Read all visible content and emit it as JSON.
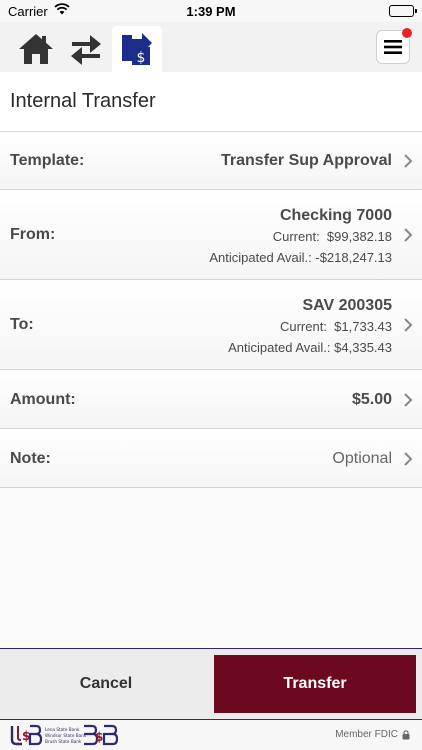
{
  "status_bar": {
    "carrier": "Carrier",
    "time": "1:39 PM",
    "battery_level": 100
  },
  "toolbar": {
    "icons": [
      "home-icon",
      "swap-icon",
      "transfer-icon",
      "menu-icon"
    ],
    "active_icon_color": "#1b2c8a",
    "notification_color": "#e8222b"
  },
  "page": {
    "title": "Internal Transfer"
  },
  "form": {
    "template": {
      "label": "Template:",
      "value": "Transfer Sup Approval"
    },
    "from": {
      "label": "From:",
      "account": "Checking 7000",
      "current_label": "Current:",
      "current_value": "$99,382.18",
      "anticipated_label": "Anticipated Avail.:",
      "anticipated_value": "-$218,247.13"
    },
    "to": {
      "label": "To:",
      "account": "SAV 200305",
      "current_label": "Current:",
      "current_value": "$1,733.43",
      "anticipated_label": "Anticipated Avail.:",
      "anticipated_value": "$4,335.43"
    },
    "amount": {
      "label": "Amount:",
      "value": "$5.00"
    },
    "note": {
      "label": "Note:",
      "placeholder": "Optional"
    }
  },
  "actions": {
    "cancel_label": "Cancel",
    "transfer_label": "Transfer",
    "transfer_color": "#6b0a1e",
    "border_color": "#2e2a6e"
  },
  "footer": {
    "fdic_text": "Member FDIC",
    "bank_names": [
      "Lena State Bank",
      "Windsor State Bank",
      "Brush State Bank"
    ]
  }
}
